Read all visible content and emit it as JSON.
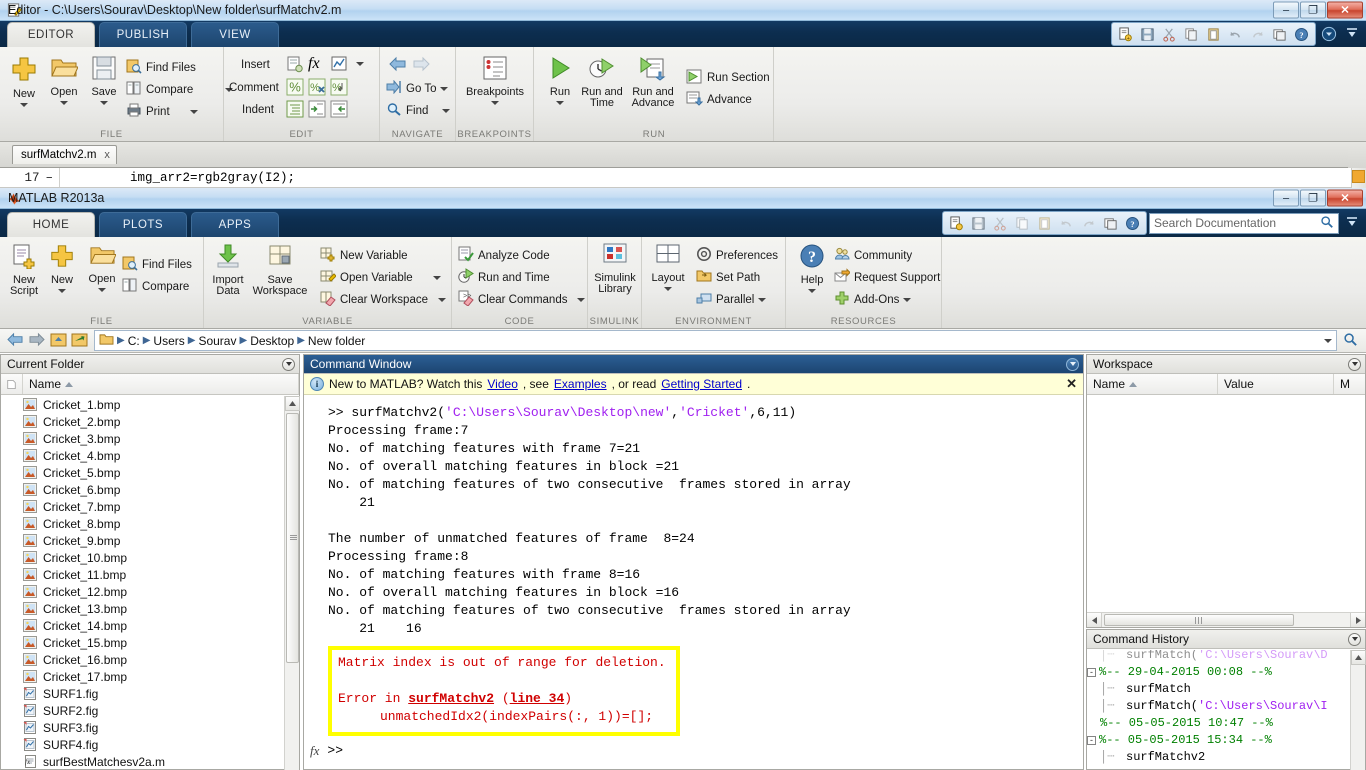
{
  "editor_window": {
    "title": "Editor - C:\\Users\\Sourav\\Desktop\\New folder\\surfMatchv2.m",
    "tabs": [
      {
        "label": "EDITOR",
        "active": true
      },
      {
        "label": "PUBLISH",
        "active": false
      },
      {
        "label": "VIEW",
        "active": false
      }
    ],
    "window_buttons": {
      "minimize": "–",
      "maximize": "❐",
      "close": "✕"
    },
    "quick_access_icons": [
      "new-script-icon",
      "save-icon",
      "cut-icon",
      "copy-icon",
      "paste-icon",
      "undo-icon",
      "redo-icon",
      "switch-windows-icon",
      "help-icon"
    ],
    "collapse_icon": "chevron-down-circle-icon",
    "minimize_ribbon_icon": "minimize-ribbon-icon",
    "groups": [
      {
        "name": "FILE",
        "big_buttons": [
          {
            "label": "New",
            "icon": "new-plus-icon",
            "has_caret": true
          },
          {
            "label": "Open",
            "icon": "open-folder-icon",
            "has_caret": true
          },
          {
            "label": "Save",
            "icon": "save-disk-icon",
            "has_caret": true
          }
        ],
        "small_buttons": [
          {
            "label": "Find Files",
            "icon": "find-files-icon",
            "has_caret": false
          },
          {
            "label": "Compare",
            "icon": "compare-icon",
            "has_caret": true
          },
          {
            "label": "Print",
            "icon": "print-icon",
            "has_caret": true
          }
        ]
      },
      {
        "name": "EDIT",
        "rows": [
          {
            "label": "Insert",
            "icons": [
              "insert-snippet-icon",
              "fx-function-icon",
              "figure-icon"
            ],
            "has_caret": true
          },
          {
            "label": "Comment",
            "icons": [
              "comment-percent-icon",
              "uncomment-icon",
              "wrap-comment-icon"
            ],
            "has_caret": false
          },
          {
            "label": "Indent",
            "icons": [
              "smart-indent-icon",
              "indent-right-icon",
              "indent-left-icon"
            ],
            "has_caret": false
          }
        ]
      },
      {
        "name": "NAVIGATE",
        "small_buttons": [
          {
            "label": "",
            "icon": "back-arrow-icon",
            "has_caret": false
          },
          {
            "label": "",
            "icon": "forward-arrow-icon",
            "has_caret": false
          },
          {
            "label": "Go To",
            "icon": "go-to-icon",
            "has_caret": true
          },
          {
            "label": "Find",
            "icon": "find-magnifier-icon",
            "has_caret": true
          }
        ]
      },
      {
        "name": "BREAKPOINTS",
        "big_buttons": [
          {
            "label": "Breakpoints",
            "icon": "breakpoints-icon",
            "has_caret": true
          }
        ]
      },
      {
        "name": "RUN",
        "big_buttons": [
          {
            "label": "Run",
            "icon": "run-play-icon",
            "has_caret": true
          },
          {
            "label": "Run and Time",
            "icon": "run-and-time-icon",
            "has_caret": false
          },
          {
            "label": "Run and Advance",
            "icon": "run-and-advance-icon",
            "has_caret": false
          }
        ],
        "small_buttons": [
          {
            "label": "Run Section",
            "icon": "run-section-icon",
            "has_caret": false
          },
          {
            "label": "Advance",
            "icon": "advance-icon",
            "has_caret": false
          }
        ]
      }
    ],
    "document_tab": {
      "label": "surfMatchv2.m",
      "close": "x"
    },
    "code": {
      "line_number": "17",
      "breakpoint_dash": "–",
      "text": "img_arr2=rgb2gray(I2);"
    }
  },
  "matlab_window": {
    "title": "MATLAB R2013a",
    "window_buttons": {
      "minimize": "–",
      "maximize": "❐",
      "close": "✕"
    },
    "tabs": [
      {
        "label": "HOME",
        "active": true
      },
      {
        "label": "PLOTS",
        "active": false
      },
      {
        "label": "APPS",
        "active": false
      }
    ],
    "quick_access_icons": [
      "new-script-icon",
      "save-icon",
      "cut-icon",
      "copy-icon",
      "paste-icon",
      "undo-icon",
      "redo-icon",
      "switch-windows-icon",
      "help-icon"
    ],
    "search": {
      "placeholder": "Search Documentation",
      "value": "",
      "icon": "search-magnifier-icon"
    },
    "groups": [
      {
        "name": "FILE",
        "big_buttons": [
          {
            "label": "New Script",
            "icon": "new-script-icon",
            "has_caret": false
          },
          {
            "label": "New",
            "icon": "new-plus-icon",
            "has_caret": true
          },
          {
            "label": "Open",
            "icon": "open-folder-icon",
            "has_caret": true
          }
        ],
        "small_buttons": [
          {
            "label": "Find Files",
            "icon": "find-files-icon",
            "has_caret": false
          },
          {
            "label": "Compare",
            "icon": "compare-icon",
            "has_caret": false
          }
        ]
      },
      {
        "name": "VARIABLE",
        "big_buttons": [
          {
            "label": "Import Data",
            "icon": "import-data-icon",
            "has_caret": false
          },
          {
            "label": "Save Workspace",
            "icon": "save-workspace-icon",
            "has_caret": false
          }
        ],
        "small_buttons": [
          {
            "label": "New Variable",
            "icon": "new-variable-icon",
            "has_caret": false
          },
          {
            "label": "Open Variable",
            "icon": "open-variable-icon",
            "has_caret": true
          },
          {
            "label": "Clear Workspace",
            "icon": "clear-workspace-icon",
            "has_caret": true
          }
        ]
      },
      {
        "name": "CODE",
        "small_buttons": [
          {
            "label": "Analyze Code",
            "icon": "analyze-code-icon",
            "has_caret": false
          },
          {
            "label": "Run and Time",
            "icon": "run-and-time-icon",
            "has_caret": false
          },
          {
            "label": "Clear Commands",
            "icon": "clear-commands-icon",
            "has_caret": true
          }
        ]
      },
      {
        "name": "SIMULINK",
        "big_buttons": [
          {
            "label": "Simulink Library",
            "icon": "simulink-library-icon",
            "has_caret": false
          }
        ]
      },
      {
        "name": "ENVIRONMENT",
        "big_buttons": [
          {
            "label": "Layout",
            "icon": "layout-icon",
            "has_caret": true
          }
        ],
        "small_buttons": [
          {
            "label": "Preferences",
            "icon": "preferences-gear-icon",
            "has_caret": false
          },
          {
            "label": "Set Path",
            "icon": "set-path-icon",
            "has_caret": false
          },
          {
            "label": "Parallel",
            "icon": "parallel-icon",
            "has_caret": true
          }
        ]
      },
      {
        "name": "RESOURCES",
        "big_buttons": [
          {
            "label": "Help",
            "icon": "help-question-icon",
            "has_caret": true
          }
        ],
        "small_buttons": [
          {
            "label": "Community",
            "icon": "community-icon",
            "has_caret": false
          },
          {
            "label": "Request Support",
            "icon": "request-support-icon",
            "has_caret": false
          },
          {
            "label": "Add-Ons",
            "icon": "add-ons-icon",
            "has_caret": true
          }
        ]
      }
    ],
    "address_bar": {
      "back_icon": "back-arrow-icon",
      "forward_icon": "forward-arrow-icon",
      "up_icon": "up-folder-icon",
      "browse_icon": "browse-folder-icon",
      "folder_icon": "folder-icon",
      "crumbs": [
        "C:",
        "Users",
        "Sourav",
        "Desktop",
        "New folder"
      ],
      "dropdown_icon": "chevron-down-icon",
      "search_icon": "search-magnifier-icon"
    }
  },
  "current_folder": {
    "title": "Current Folder",
    "columns": [
      "Name"
    ],
    "sort_indicator": "▲",
    "files": [
      {
        "name": "Cricket_1.bmp",
        "type": "bmp"
      },
      {
        "name": "Cricket_2.bmp",
        "type": "bmp"
      },
      {
        "name": "Cricket_3.bmp",
        "type": "bmp"
      },
      {
        "name": "Cricket_4.bmp",
        "type": "bmp"
      },
      {
        "name": "Cricket_5.bmp",
        "type": "bmp"
      },
      {
        "name": "Cricket_6.bmp",
        "type": "bmp"
      },
      {
        "name": "Cricket_7.bmp",
        "type": "bmp"
      },
      {
        "name": "Cricket_8.bmp",
        "type": "bmp"
      },
      {
        "name": "Cricket_9.bmp",
        "type": "bmp"
      },
      {
        "name": "Cricket_10.bmp",
        "type": "bmp"
      },
      {
        "name": "Cricket_11.bmp",
        "type": "bmp"
      },
      {
        "name": "Cricket_12.bmp",
        "type": "bmp"
      },
      {
        "name": "Cricket_13.bmp",
        "type": "bmp"
      },
      {
        "name": "Cricket_14.bmp",
        "type": "bmp"
      },
      {
        "name": "Cricket_15.bmp",
        "type": "bmp"
      },
      {
        "name": "Cricket_16.bmp",
        "type": "bmp"
      },
      {
        "name": "Cricket_17.bmp",
        "type": "bmp"
      },
      {
        "name": "SURF1.fig",
        "type": "fig"
      },
      {
        "name": "SURF2.fig",
        "type": "fig"
      },
      {
        "name": "SURF3.fig",
        "type": "fig"
      },
      {
        "name": "SURF4.fig",
        "type": "fig"
      },
      {
        "name": "surfBestMatchesv2a.m",
        "type": "m"
      }
    ]
  },
  "command_window": {
    "title": "Command Window",
    "notice": {
      "prefix": "New to MATLAB? Watch this ",
      "link1": "Video",
      "mid1": ", see ",
      "link2": "Examples",
      "mid2": ", or read ",
      "link3": "Getting Started",
      "suffix": ".",
      "close": "✕"
    },
    "lines": [
      {
        "kind": "cmd",
        "prompt": ">> ",
        "parts": [
          {
            "t": "surfMatchv2(",
            "c": "black"
          },
          {
            "t": "'C:\\Users\\Sourav\\Desktop\\new'",
            "c": "purple"
          },
          {
            "t": ",",
            "c": "black"
          },
          {
            "t": "'Cricket'",
            "c": "purple"
          },
          {
            "t": ",6,11)",
            "c": "black"
          }
        ]
      },
      {
        "kind": "out",
        "text": "Processing frame:7"
      },
      {
        "kind": "out",
        "text": "No. of matching features with frame 7=21"
      },
      {
        "kind": "out",
        "text": "No. of overall matching features in block =21"
      },
      {
        "kind": "out",
        "text": "No. of matching features of two consecutive  frames stored in array"
      },
      {
        "kind": "out",
        "text": "    21"
      },
      {
        "kind": "out",
        "text": ""
      },
      {
        "kind": "out",
        "text": "The number of unmatched features of frame  8=24"
      },
      {
        "kind": "out",
        "text": "Processing frame:8"
      },
      {
        "kind": "out",
        "text": "No. of matching features with frame 8=16"
      },
      {
        "kind": "out",
        "text": "No. of overall matching features in block =16"
      },
      {
        "kind": "out",
        "text": "No. of matching features of two consecutive  frames stored in array"
      },
      {
        "kind": "out",
        "text": "    21    16"
      }
    ],
    "error_box": {
      "message": "Matrix index is out of range for deletion.",
      "error_prefix": "Error in ",
      "error_fn": "surfMatchv2",
      "error_paren_open": " (",
      "error_line": "line 34",
      "error_paren_close": ")",
      "error_code": "unmatchedIdx2(indexPairs(:, 1))=[];"
    },
    "prompt": ">>",
    "fx_icon": "fx-function-icon"
  },
  "workspace": {
    "title": "Workspace",
    "columns": [
      "Name",
      "Value",
      "M"
    ],
    "sort_indicator": "▲",
    "rows": []
  },
  "command_history": {
    "title": "Command History",
    "entries": [
      {
        "indent": 1,
        "box": "",
        "parts": [
          {
            "t": "surfMatch(",
            "c": "black"
          },
          {
            "t": "'C:\\Users\\Sourav\\D",
            "c": "purple"
          }
        ],
        "clipped": true
      },
      {
        "indent": 0,
        "box": "-",
        "parts": [
          {
            "t": "%-- 29-04-2015 00:08 --%",
            "c": "green"
          }
        ]
      },
      {
        "indent": 1,
        "box": "",
        "parts": [
          {
            "t": "surfMatch",
            "c": "black"
          }
        ]
      },
      {
        "indent": 1,
        "box": "",
        "parts": [
          {
            "t": "surfMatch(",
            "c": "black"
          },
          {
            "t": "'C:\\Users\\Sourav\\I",
            "c": "purple"
          }
        ]
      },
      {
        "indent": 0,
        "box": "",
        "parts": [
          {
            "t": "%-- 05-05-2015 10:47 --%",
            "c": "green"
          }
        ]
      },
      {
        "indent": 0,
        "box": "-",
        "parts": [
          {
            "t": "%-- 05-05-2015 15:34 --%",
            "c": "green"
          }
        ]
      },
      {
        "indent": 1,
        "box": "",
        "parts": [
          {
            "t": "surfMatchv2",
            "c": "black"
          }
        ]
      }
    ]
  },
  "colors": {
    "ribbon_tab_bar": "#0d2e50",
    "active_panel_title": "#255a8e",
    "error_highlight": "#ffff00",
    "error_text": "#d00000",
    "string_purple": "#a020f0",
    "history_green": "#008000",
    "notice_bg": "#ffffd7",
    "link_blue": "#0000cc"
  }
}
